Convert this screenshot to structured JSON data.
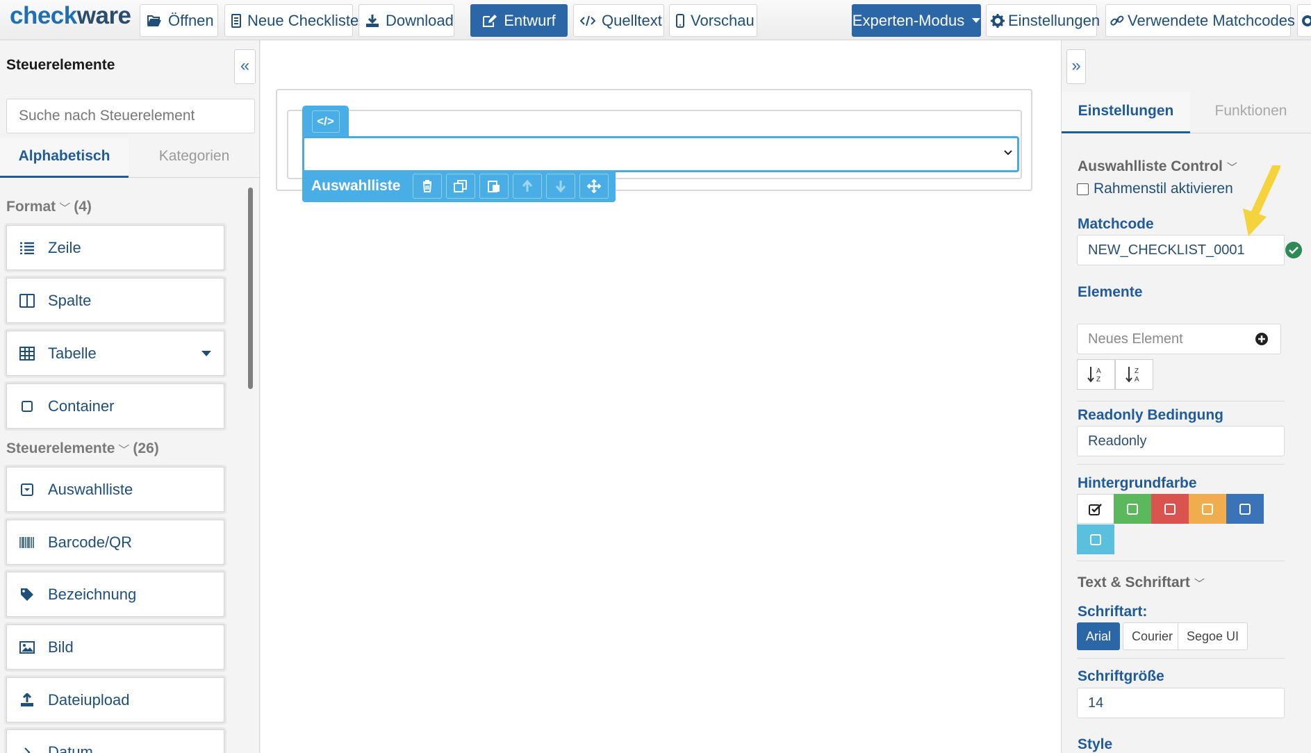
{
  "app": {
    "logo_part1": "check",
    "logo_part2": "ware"
  },
  "toolbar": {
    "open": "Öffnen",
    "new_checklist": "Neue Checkliste",
    "download": "Download",
    "design": "Entwurf",
    "source": "Quelltext",
    "preview": "Vorschau",
    "expert_mode": "Experten-Modus",
    "settings": "Einstellungen",
    "matchcodes": "Verwendete Matchcodes"
  },
  "left_panel": {
    "title": "Steuerelemente",
    "collapse_glyph": "«",
    "search_placeholder": "Suche nach Steuerelement",
    "tabs": [
      "Alphabetisch",
      "Kategorien"
    ],
    "format_section": {
      "label": "Format",
      "count": "(4)"
    },
    "format_items": [
      "Zeile",
      "Spalte",
      "Tabelle",
      "Container"
    ],
    "controls_section": {
      "label": "Steuerelemente",
      "count": "(26)"
    },
    "control_items": [
      "Auswahlliste",
      "Barcode/QR",
      "Bezeichnung",
      "Bild",
      "Dateiupload",
      "Datum"
    ]
  },
  "canvas": {
    "code_glyph": "</>",
    "selected_control_label": "Auswahlliste"
  },
  "right_panel": {
    "expand_glyph": "»",
    "tabs": [
      "Einstellungen",
      "Funktionen"
    ],
    "control_type": "Auswahlliste Control",
    "frame_style_label": "Rahmenstil aktivieren",
    "matchcode_label": "Matchcode",
    "matchcode_value": "NEW_CHECKLIST_0001",
    "elements_label": "Elemente",
    "new_element_placeholder": "Neues Element",
    "readonly_label": "Readonly Bedingung",
    "readonly_placeholder": "Readonly",
    "bgcolor_label": "Hintergrundfarbe",
    "bg_colors": [
      "#ffffff",
      "#5cb85c",
      "#d9534f",
      "#f0ad4e",
      "#3a73b8",
      "#5bc0de"
    ],
    "text_font_section": "Text & Schriftart",
    "font_label": "Schriftart:",
    "fonts": [
      "Arial",
      "Courier",
      "Segoe UI"
    ],
    "selected_font": "Arial",
    "font_size_label": "Schriftgröße",
    "font_size_value": "14",
    "style_label": "Style"
  },
  "colors": {
    "accent": "#1f5b9a",
    "primary_button": "#2b66a6",
    "selection": "#4aaee6",
    "valid": "#2e8b57",
    "annotation_arrow": "#f5d33c"
  }
}
